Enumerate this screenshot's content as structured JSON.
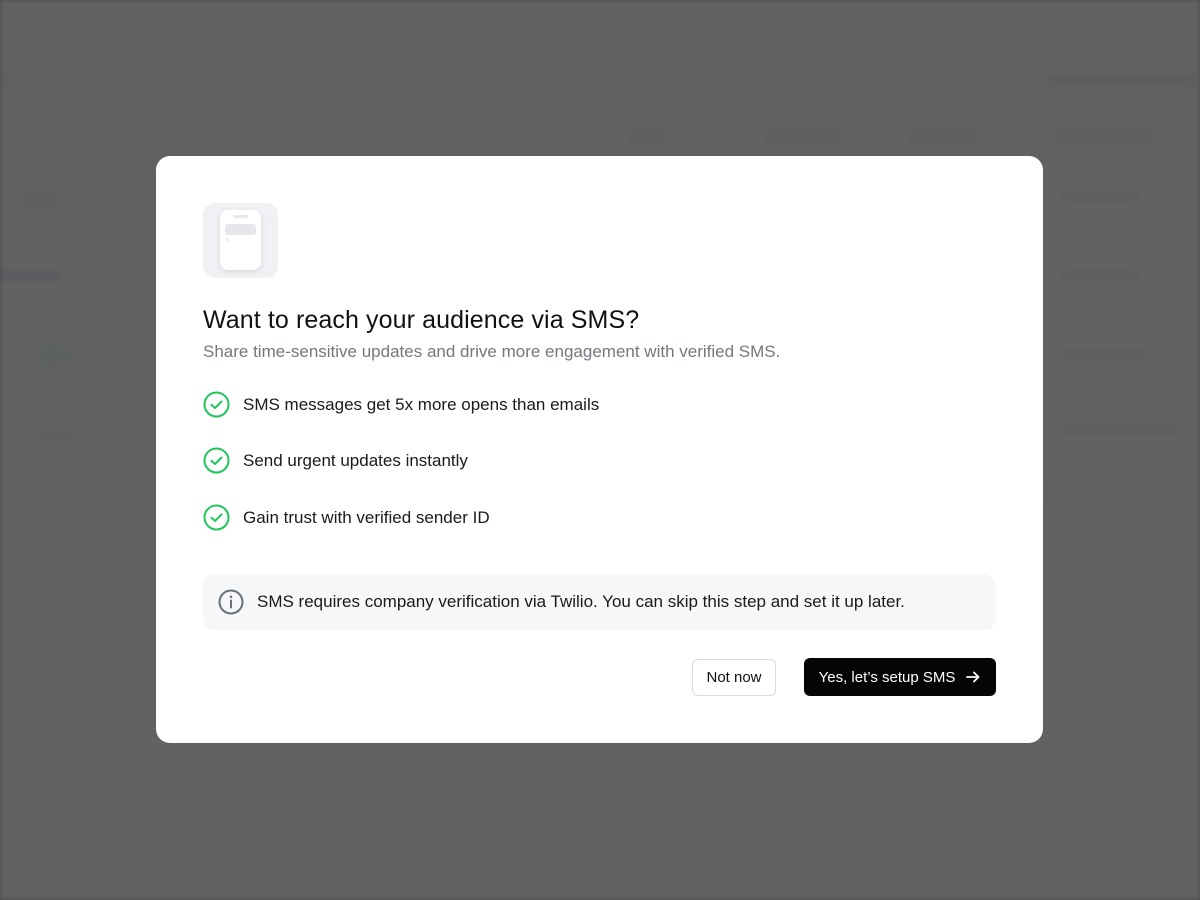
{
  "modal": {
    "title": "Want to reach your audience via SMS?",
    "subtitle": "Share time-sensitive updates and drive more engagement with verified SMS.",
    "features": [
      {
        "label": "SMS messages get 5x more opens than emails",
        "icon": "check-circle-icon"
      },
      {
        "label": "Send urgent updates instantly",
        "icon": "check-circle-icon"
      },
      {
        "label": "Gain trust with verified sender ID",
        "icon": "check-circle-icon"
      }
    ],
    "info": {
      "icon": "info-icon",
      "text": "SMS requires company verification via Twilio. You can skip this step and set it up later."
    },
    "buttons": {
      "secondary_label": "Not now",
      "primary_label": "Yes, let’s setup SMS",
      "primary_icon": "arrow-right-icon"
    },
    "header_icon": "phone-message-icon"
  },
  "colors": {
    "check_green": "#22c55e",
    "primary_button": "#050505",
    "overlay": "#5f5f5f"
  }
}
